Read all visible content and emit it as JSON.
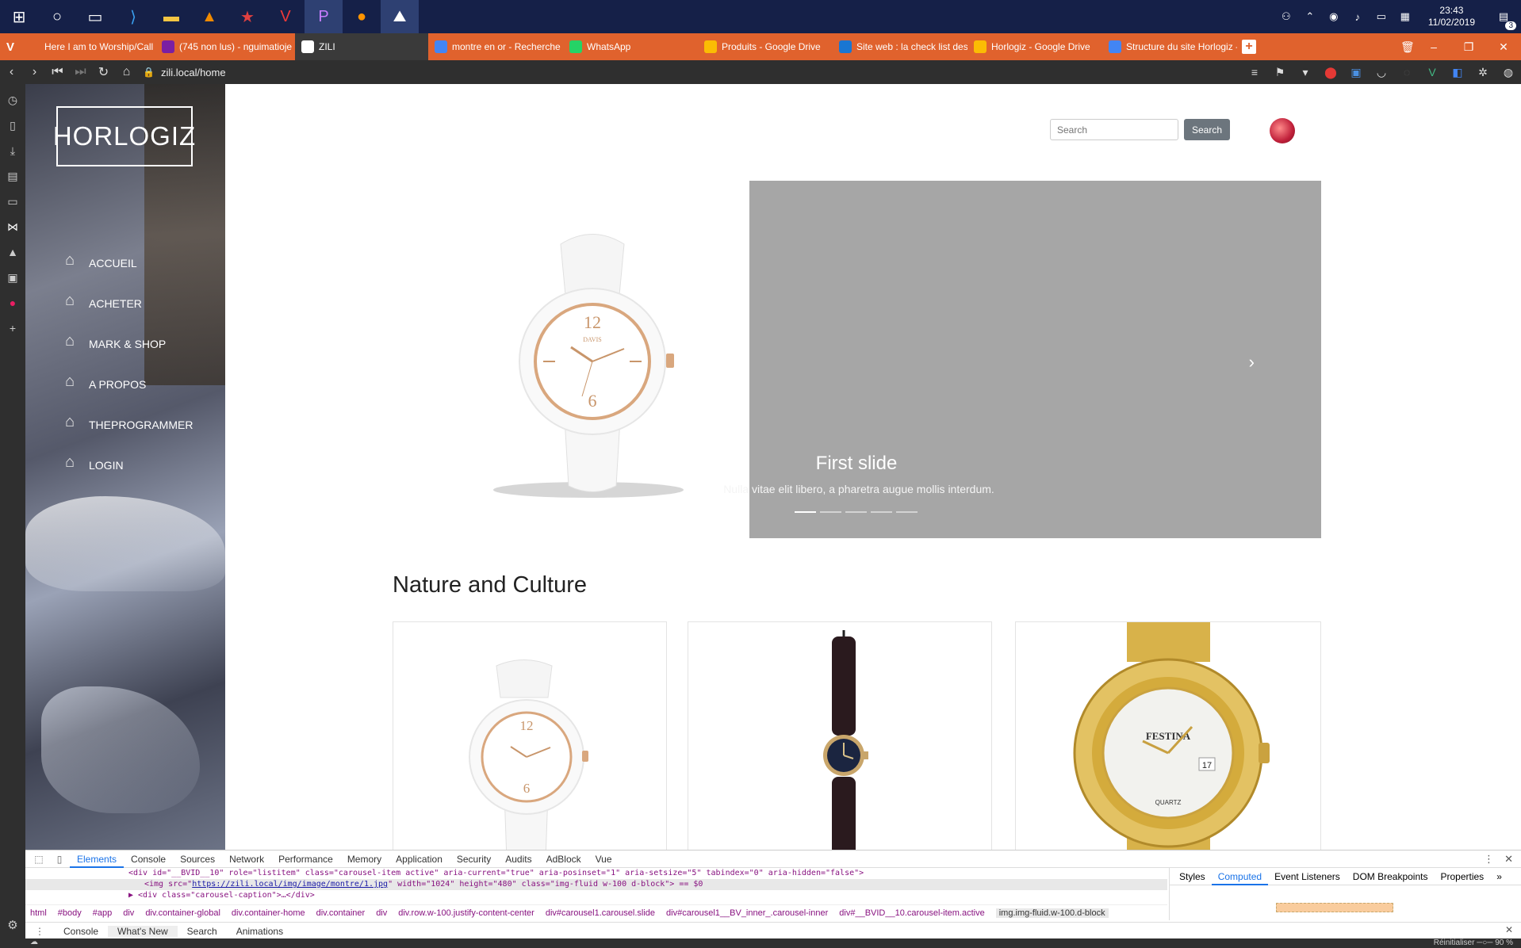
{
  "taskbar": {
    "clock_time": "23:43",
    "clock_date": "11/02/2019",
    "notification_count": "3"
  },
  "browser": {
    "tabs": [
      {
        "label": "Here I am to Worship/Call -",
        "icon": "speaker-icon",
        "color": "#e0622d"
      },
      {
        "label": "(745 non lus) - nguimatioje",
        "icon": "mail-icon",
        "color": "#7b1fa2"
      },
      {
        "label": "ZILI",
        "icon": "page-icon",
        "color": "#ffffff"
      },
      {
        "label": "montre en or - Recherche G",
        "icon": "google-icon",
        "color": "#4285f4"
      },
      {
        "label": "WhatsApp",
        "icon": "whatsapp-icon",
        "color": "#25d366"
      },
      {
        "label": "Produits - Google Drive",
        "icon": "drive-icon",
        "color": "#fbbc04"
      },
      {
        "label": "Site web : la check list des fo",
        "icon": "c-icon",
        "color": "#1976d2"
      },
      {
        "label": "Horlogiz - Google Drive",
        "icon": "drive-icon",
        "color": "#fbbc04"
      },
      {
        "label": "Structure du site Horlogiz -",
        "icon": "docs-icon",
        "color": "#4285f4"
      }
    ],
    "url": "zili.local/home"
  },
  "site": {
    "logo": "HORLOGIZ",
    "menu": [
      "ACCUEIL",
      "ACHETER",
      "MARK & SHOP",
      "A PROPOS",
      "THEPROGRAMMER",
      "LOGIN"
    ],
    "search_placeholder": "Search",
    "search_button": "Search",
    "carousel": {
      "title": "First slide",
      "caption": "Nulla vitae elit libero, a pharetra augue mollis interdum.",
      "slide_count": 5,
      "active_index": 0
    },
    "section_title": "Nature and Culture",
    "watch_brand_1": "DAVIS",
    "watch_brand_3": "FESTINA",
    "watch_3_label": "QUARTZ",
    "watch_3_date": "17"
  },
  "devtools": {
    "tabs": [
      "Elements",
      "Console",
      "Sources",
      "Network",
      "Performance",
      "Memory",
      "Application",
      "Security",
      "Audits",
      "AdBlock",
      "Vue"
    ],
    "code_line_1": "<div id=\"__BVID__10\" role=\"listitem\" class=\"carousel-item active\" aria-current=\"true\" aria-posinset=\"1\" aria-setsize=\"5\" tabindex=\"0\" aria-hidden=\"false\">",
    "code_line_2_prefix": "<img src=\"",
    "code_line_2_link": "https://zili.local/img/image/montre/1.jpg",
    "code_line_2_suffix": "\" width=\"1024\" height=\"480\" class=\"img-fluid w-100 d-block\"> == $0",
    "code_line_3": "▶ <div class=\"carousel-caption\">…</div>",
    "breadcrumbs": [
      "html",
      "#body",
      "#app",
      "div",
      "div.container-global",
      "div.container-home",
      "div.container",
      "div",
      "div.row.w-100.justify-content-center",
      "div#carousel1.carousel.slide",
      "div#carousel1__BV_inner_.carousel-inner",
      "div#__BVID__10.carousel-item.active",
      "img.img-fluid.w-100.d-block"
    ],
    "right_tabs": [
      "Styles",
      "Computed",
      "Event Listeners",
      "DOM Breakpoints",
      "Properties"
    ],
    "drawer_tabs": [
      "Console",
      "What's New",
      "Search",
      "Animations"
    ]
  },
  "status": {
    "reset_label": "Réinitialiser",
    "zoom": "90 %"
  }
}
